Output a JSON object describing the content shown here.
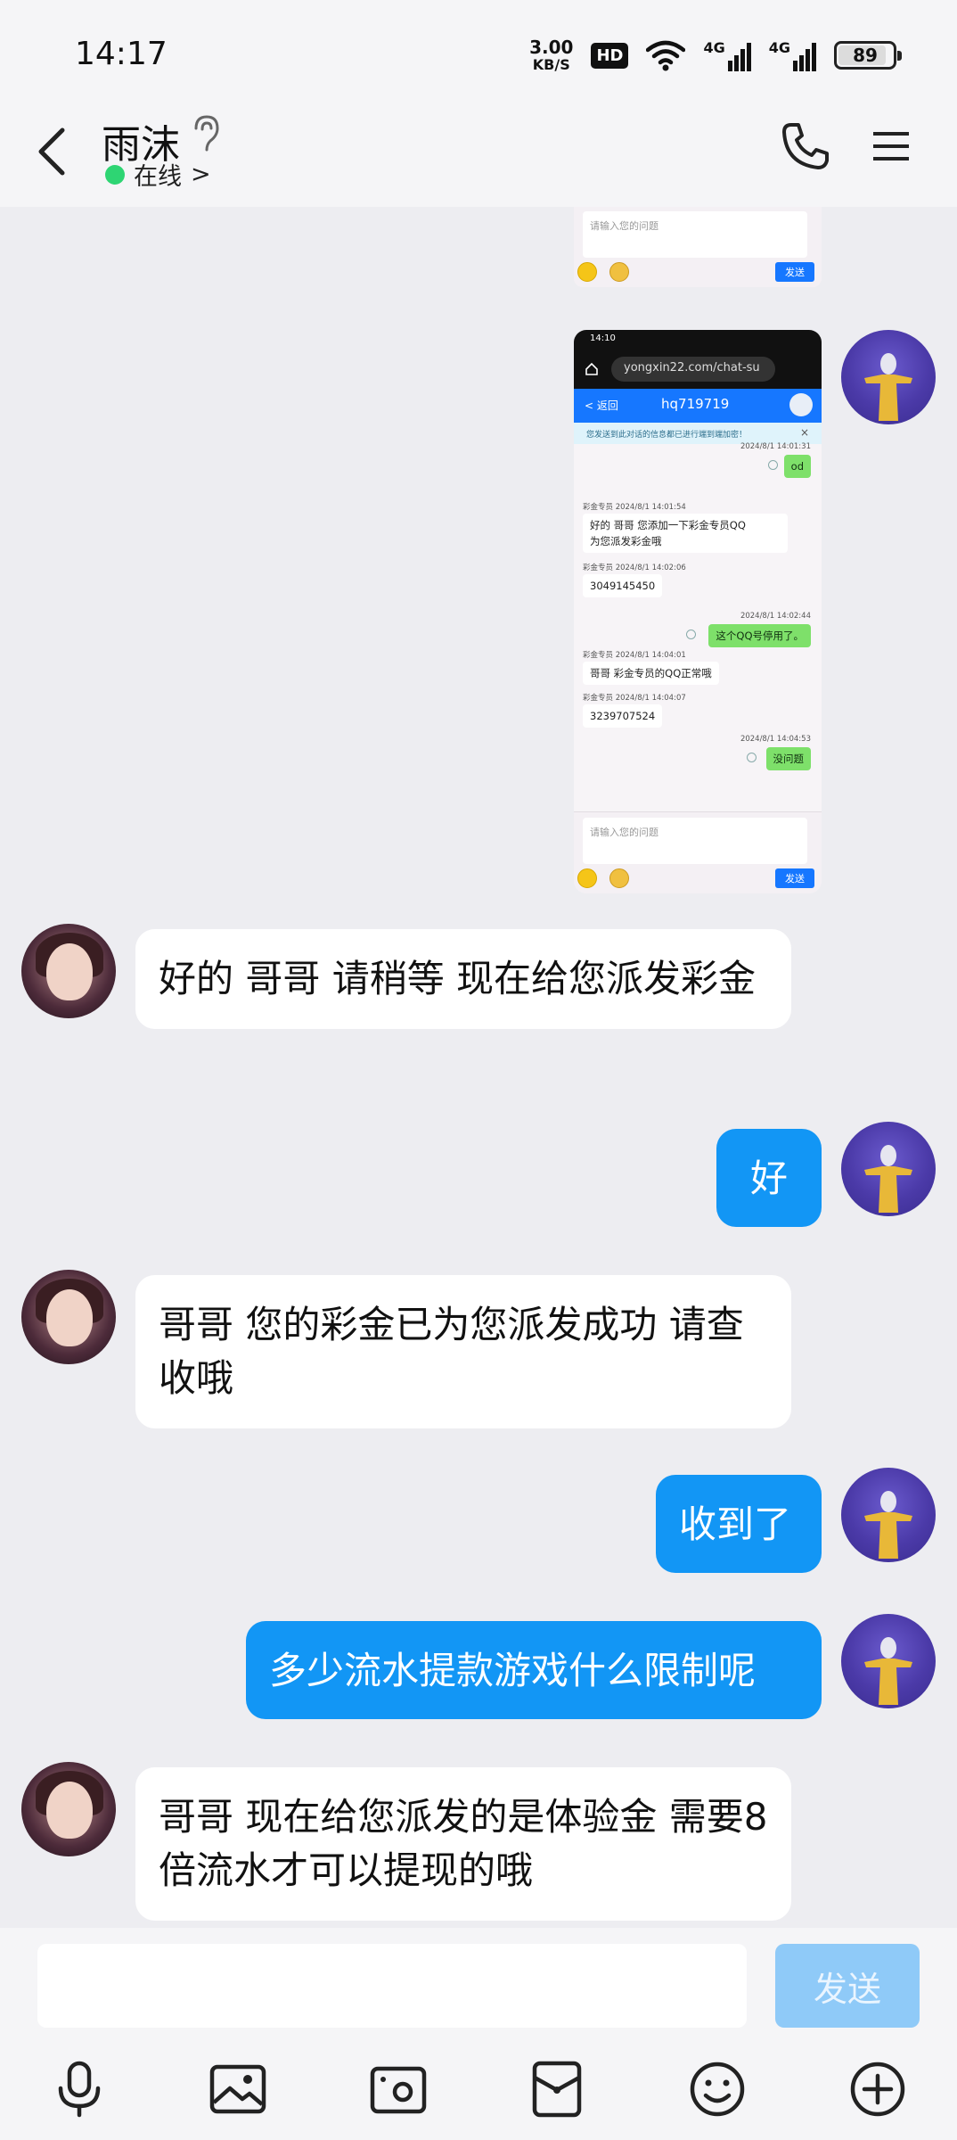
{
  "status_bar": {
    "time": "14:17",
    "net_speed_value": "3.00",
    "net_speed_unit": "KB/S",
    "hd_label": "HD",
    "signal_1": "4G",
    "signal_2": "4G",
    "battery": "89",
    "battery_level": 0.89
  },
  "header": {
    "contact_name": "雨沫",
    "presence": "在线",
    "presence_chevron": ">"
  },
  "shot_top": {
    "input_placeholder": "请输入您的问题",
    "send_label": "发送"
  },
  "shot_main": {
    "status_time": "14:10",
    "url": "yongxin22.com/chat-su",
    "back_label": "< 返回",
    "title": "hq719719",
    "notice": "您发送到此对话的信息都已进行端到端加密！",
    "notice_close": "×",
    "messages": [
      {
        "dir": "out",
        "meta": "2024/8/1 14:01:31",
        "text": "od"
      },
      {
        "dir": "in",
        "meta": "彩金专员 2024/8/1 14:01:54",
        "text": "好的 哥哥 您添加一下彩金专员QQ\n为您派发彩金哦"
      },
      {
        "dir": "in",
        "meta": "彩金专员 2024/8/1 14:02:06",
        "text": "3049145450"
      },
      {
        "dir": "out",
        "meta": "2024/8/1 14:02:44",
        "text": "这个QQ号停用了。"
      },
      {
        "dir": "in",
        "meta": "彩金专员 2024/8/1 14:04:01",
        "text": "哥哥 彩金专员的QQ正常哦"
      },
      {
        "dir": "in",
        "meta": "彩金专员 2024/8/1 14:04:07",
        "text": "3239707524"
      },
      {
        "dir": "out",
        "meta": "2024/8/1 14:04:53",
        "text": "没问题"
      }
    ],
    "input_placeholder": "请输入您的问题",
    "send_label": "发送"
  },
  "chat": {
    "messages": [
      {
        "dir": "in",
        "text": "好的  哥哥 请稍等 现在给您派发彩金"
      },
      {
        "dir": "out",
        "text": "好"
      },
      {
        "dir": "in",
        "text": "哥哥  您的彩金已为您派发成功 请查收哦"
      },
      {
        "dir": "out",
        "text": "收到了"
      },
      {
        "dir": "out",
        "text": "多少流水提款游戏什么限制呢"
      },
      {
        "dir": "in",
        "text": "哥哥 现在给您派发的是体验金 需要8倍流水才可以提现的哦"
      }
    ]
  },
  "composer": {
    "send_label": "发送"
  },
  "toolbar": {
    "icons": [
      "microphone-icon",
      "image-icon",
      "camera-icon",
      "red-packet-icon",
      "emoji-icon",
      "plus-icon"
    ]
  },
  "colors": {
    "accent": "#1296f5",
    "send_disabled": "#8fcaf8",
    "online": "#2ed573",
    "background": "#ededf1"
  }
}
